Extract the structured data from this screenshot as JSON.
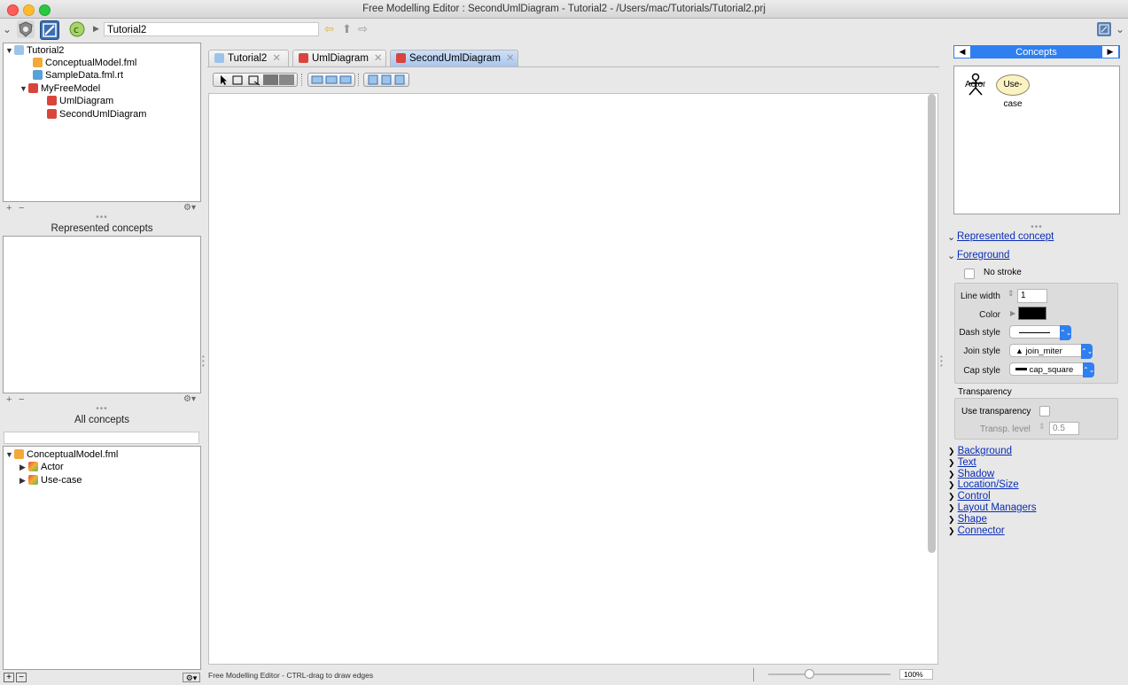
{
  "window": {
    "title": "Free Modelling Editor : SecondUmlDiagram - Tutorial2 - /Users/mac/Tutorials/Tutorial2.prj"
  },
  "toolbar": {
    "breadcrumb": "Tutorial2"
  },
  "project_tree": {
    "root": "Tutorial2",
    "items": [
      {
        "label": "ConceptualModel.fml"
      },
      {
        "label": "SampleData.fml.rt"
      },
      {
        "label": "MyFreeModel"
      },
      {
        "label": "UmlDiagram"
      },
      {
        "label": "SecondUmlDiagram"
      }
    ]
  },
  "represented_concepts": {
    "title": "Represented concepts"
  },
  "all_concepts": {
    "title": "All concepts",
    "search_value": "",
    "root": "ConceptualModel.fml",
    "items": [
      {
        "label": "Actor"
      },
      {
        "label": "Use-case"
      }
    ]
  },
  "tabs": [
    {
      "label": "Tutorial2"
    },
    {
      "label": "UmlDiagram"
    },
    {
      "label": "SecondUmlDiagram",
      "active": true
    }
  ],
  "status": {
    "text": "Free Modelling Editor - CTRL-drag to draw edges",
    "zoom": "100%",
    "zoom_level": 0.33
  },
  "palette": {
    "title": "Concepts",
    "items": [
      {
        "label": "Actor",
        "icon": "stick-figure-icon"
      },
      {
        "label": "Use-case",
        "icon": "ellipse-icon"
      }
    ]
  },
  "inspector": {
    "represented_concept": "Represented concept",
    "foreground": "Foreground",
    "no_stroke": "No stroke",
    "line_width_label": "Line width",
    "line_width_value": "1",
    "color_label": "Color",
    "color_value": "#000000",
    "dash_style_label": "Dash style",
    "join_style_label": "Join style",
    "join_style_value": "join_miter",
    "cap_style_label": "Cap style",
    "cap_style_value": "cap_square",
    "transparency": "Transparency",
    "use_transparency": "Use transparency",
    "transp_level_label": "Transp. level",
    "transp_level_value": "0.5",
    "sections": [
      {
        "label": "Background"
      },
      {
        "label": "Text"
      },
      {
        "label": "Shadow"
      },
      {
        "label": "Location/Size"
      },
      {
        "label": "Control"
      },
      {
        "label": "Layout Managers"
      },
      {
        "label": "Shape"
      },
      {
        "label": "Connector"
      }
    ]
  },
  "colors": {
    "accent": "#2f7ff0",
    "link": "#0a2db5",
    "palette_header": "#2f7ff0"
  }
}
